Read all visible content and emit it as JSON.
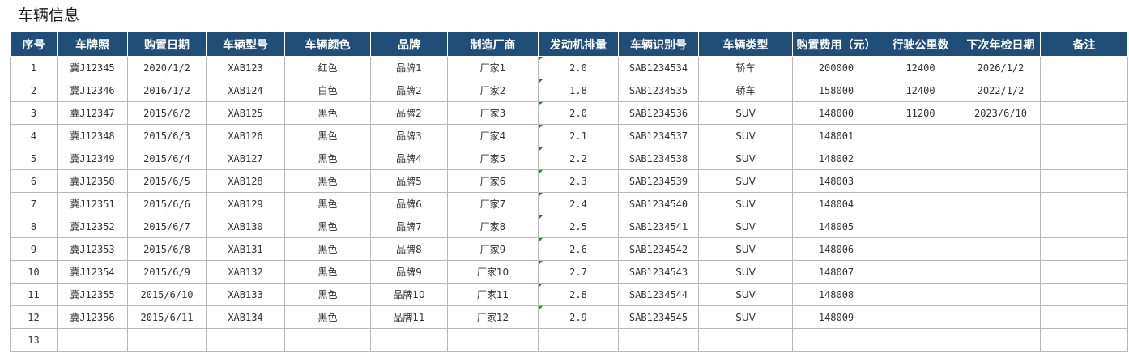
{
  "sheet": {
    "title": "车辆信息"
  },
  "table": {
    "headers": [
      "序号",
      "车牌照",
      "购置日期",
      "车辆型号",
      "车辆颜色",
      "品牌",
      "制造厂商",
      "发动机排量",
      "车辆识别号",
      "车辆类型",
      "购置费用（元）",
      "行驶公里数",
      "下次年检日期",
      "备注"
    ],
    "rows": [
      [
        "1",
        "冀J12345",
        "2020/1/2",
        "XAB123",
        "红色",
        "品牌1",
        "厂家1",
        "2.0",
        "SAB1234534",
        "轿车",
        "200000",
        "12400",
        "2026/1/2",
        ""
      ],
      [
        "2",
        "冀J12346",
        "2016/1/2",
        "XAB124",
        "白色",
        "品牌2",
        "厂家2",
        "1.8",
        "SAB1234535",
        "轿车",
        "158000",
        "12400",
        "2022/1/2",
        ""
      ],
      [
        "3",
        "冀J12347",
        "2015/6/2",
        "XAB125",
        "黑色",
        "品牌2",
        "厂家3",
        "2.0",
        "SAB1234536",
        "SUV",
        "148000",
        "11200",
        "2023/6/10",
        ""
      ],
      [
        "4",
        "冀J12348",
        "2015/6/3",
        "XAB126",
        "黑色",
        "品牌3",
        "厂家4",
        "2.1",
        "SAB1234537",
        "SUV",
        "148001",
        "",
        "",
        ""
      ],
      [
        "5",
        "冀J12349",
        "2015/6/4",
        "XAB127",
        "黑色",
        "品牌4",
        "厂家5",
        "2.2",
        "SAB1234538",
        "SUV",
        "148002",
        "",
        "",
        ""
      ],
      [
        "6",
        "冀J12350",
        "2015/6/5",
        "XAB128",
        "黑色",
        "品牌5",
        "厂家6",
        "2.3",
        "SAB1234539",
        "SUV",
        "148003",
        "",
        "",
        ""
      ],
      [
        "7",
        "冀J12351",
        "2015/6/6",
        "XAB129",
        "黑色",
        "品牌6",
        "厂家7",
        "2.4",
        "SAB1234540",
        "SUV",
        "148004",
        "",
        "",
        ""
      ],
      [
        "8",
        "冀J12352",
        "2015/6/7",
        "XAB130",
        "黑色",
        "品牌7",
        "厂家8",
        "2.5",
        "SAB1234541",
        "SUV",
        "148005",
        "",
        "",
        ""
      ],
      [
        "9",
        "冀J12353",
        "2015/6/8",
        "XAB131",
        "黑色",
        "品牌8",
        "厂家9",
        "2.6",
        "SAB1234542",
        "SUV",
        "148006",
        "",
        "",
        ""
      ],
      [
        "10",
        "冀J12354",
        "2015/6/9",
        "XAB132",
        "黑色",
        "品牌9",
        "厂家10",
        "2.7",
        "SAB1234543",
        "SUV",
        "148007",
        "",
        "",
        ""
      ],
      [
        "11",
        "冀J12355",
        "2015/6/10",
        "XAB133",
        "黑色",
        "品牌10",
        "厂家11",
        "2.8",
        "SAB1234544",
        "SUV",
        "148008",
        "",
        "",
        ""
      ],
      [
        "12",
        "冀J12356",
        "2015/6/11",
        "XAB134",
        "黑色",
        "品牌11",
        "厂家12",
        "2.9",
        "SAB1234545",
        "SUV",
        "148009",
        "",
        "",
        ""
      ],
      [
        "13",
        "",
        "",
        "",
        "",
        "",
        "",
        "",
        "",
        "",
        "",
        "",
        "",
        ""
      ]
    ]
  },
  "colors": {
    "header_bg": "#1f4e79",
    "header_text": "#ffffff",
    "grid_line": "#b8b8b8",
    "cell_text": "#333333",
    "number_as_text_flag": "#1a8a1a"
  }
}
